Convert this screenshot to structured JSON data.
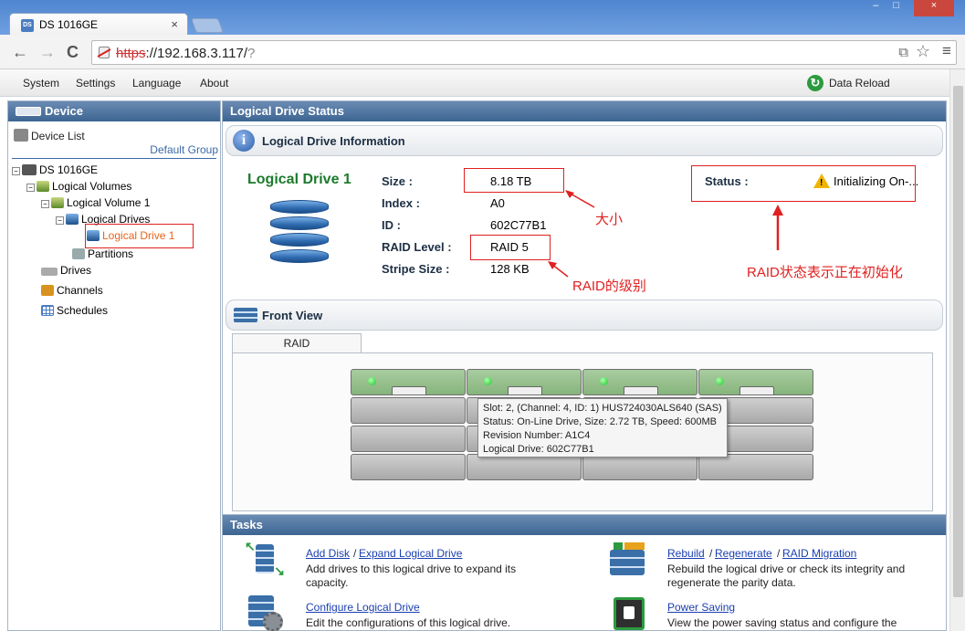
{
  "browser": {
    "tab_title": "DS 1016GE",
    "tab_favicon": "DS",
    "tab_close": "×",
    "url_scheme": "https",
    "url_host": "://192.168.3.117/",
    "url_path": "?",
    "back_icon": "←",
    "forward_icon": "→",
    "reload_icon": "C",
    "star_icon": "☆",
    "menu_icon": "≡",
    "translate_icon": "⧉",
    "window_controls": {
      "minimize": "–",
      "maximize": "□",
      "close": "×"
    }
  },
  "app_menu": {
    "items": [
      "System",
      "Settings",
      "Language",
      "About"
    ],
    "data_reload": "Data Reload"
  },
  "left_panel": {
    "title": "Device",
    "device_list": "Device List",
    "default_group": "Default Group",
    "tree": {
      "device": "DS 1016GE",
      "logical_volumes": "Logical Volumes",
      "logical_volume_1": "Logical Volume 1",
      "logical_drives": "Logical Drives",
      "logical_drive_1": "Logical Drive 1",
      "partitions": "Partitions",
      "drives": "Drives",
      "channels": "Channels",
      "schedules": "Schedules"
    }
  },
  "main": {
    "title": "Logical Drive Status",
    "info_section": "Logical Drive Information",
    "drive_name": "Logical Drive 1",
    "fields": {
      "size_label": "Size :",
      "size_value": "8.18 TB",
      "index_label": "Index :",
      "index_value": "A0",
      "id_label": "ID :",
      "id_value": "602C77B1",
      "raid_label": "RAID Level :",
      "raid_value": "RAID 5",
      "stripe_label": "Stripe Size :",
      "stripe_value": "128 KB",
      "status_label": "Status :",
      "status_value": "Initializing On-..."
    },
    "annotations": {
      "size_note": "大小",
      "raid_note": "RAID的级别",
      "status_note": "RAID状态表示正在初始化"
    },
    "front_view": {
      "title": "Front View",
      "tab": "RAID",
      "tooltip": [
        "Slot: 2, (Channel: 4, ID: 1) HUS724030ALS640 (SAS)",
        "Status: On-Line Drive, Size: 2.72 TB, Speed: 600MB",
        "Revision Number: A1C4",
        "Logical Drive: 602C77B1"
      ]
    },
    "tasks": {
      "title": "Tasks",
      "add_disk": "Add Disk",
      "sep": "/",
      "expand": "Expand Logical Drive",
      "add_desc": "Add drives to this logical drive to expand its capacity.",
      "rebuild": "Rebuild",
      "regenerate": "Regenerate",
      "raid_migration": "RAID Migration",
      "rebuild_desc": "Rebuild the logical drive or check its integrity and regenerate the parity data.",
      "configure": "Configure Logical Drive",
      "configure_desc": "Edit the configurations of this logical drive.",
      "power_saving": "Power Saving",
      "power_desc": "View the power saving status and configure the"
    }
  }
}
